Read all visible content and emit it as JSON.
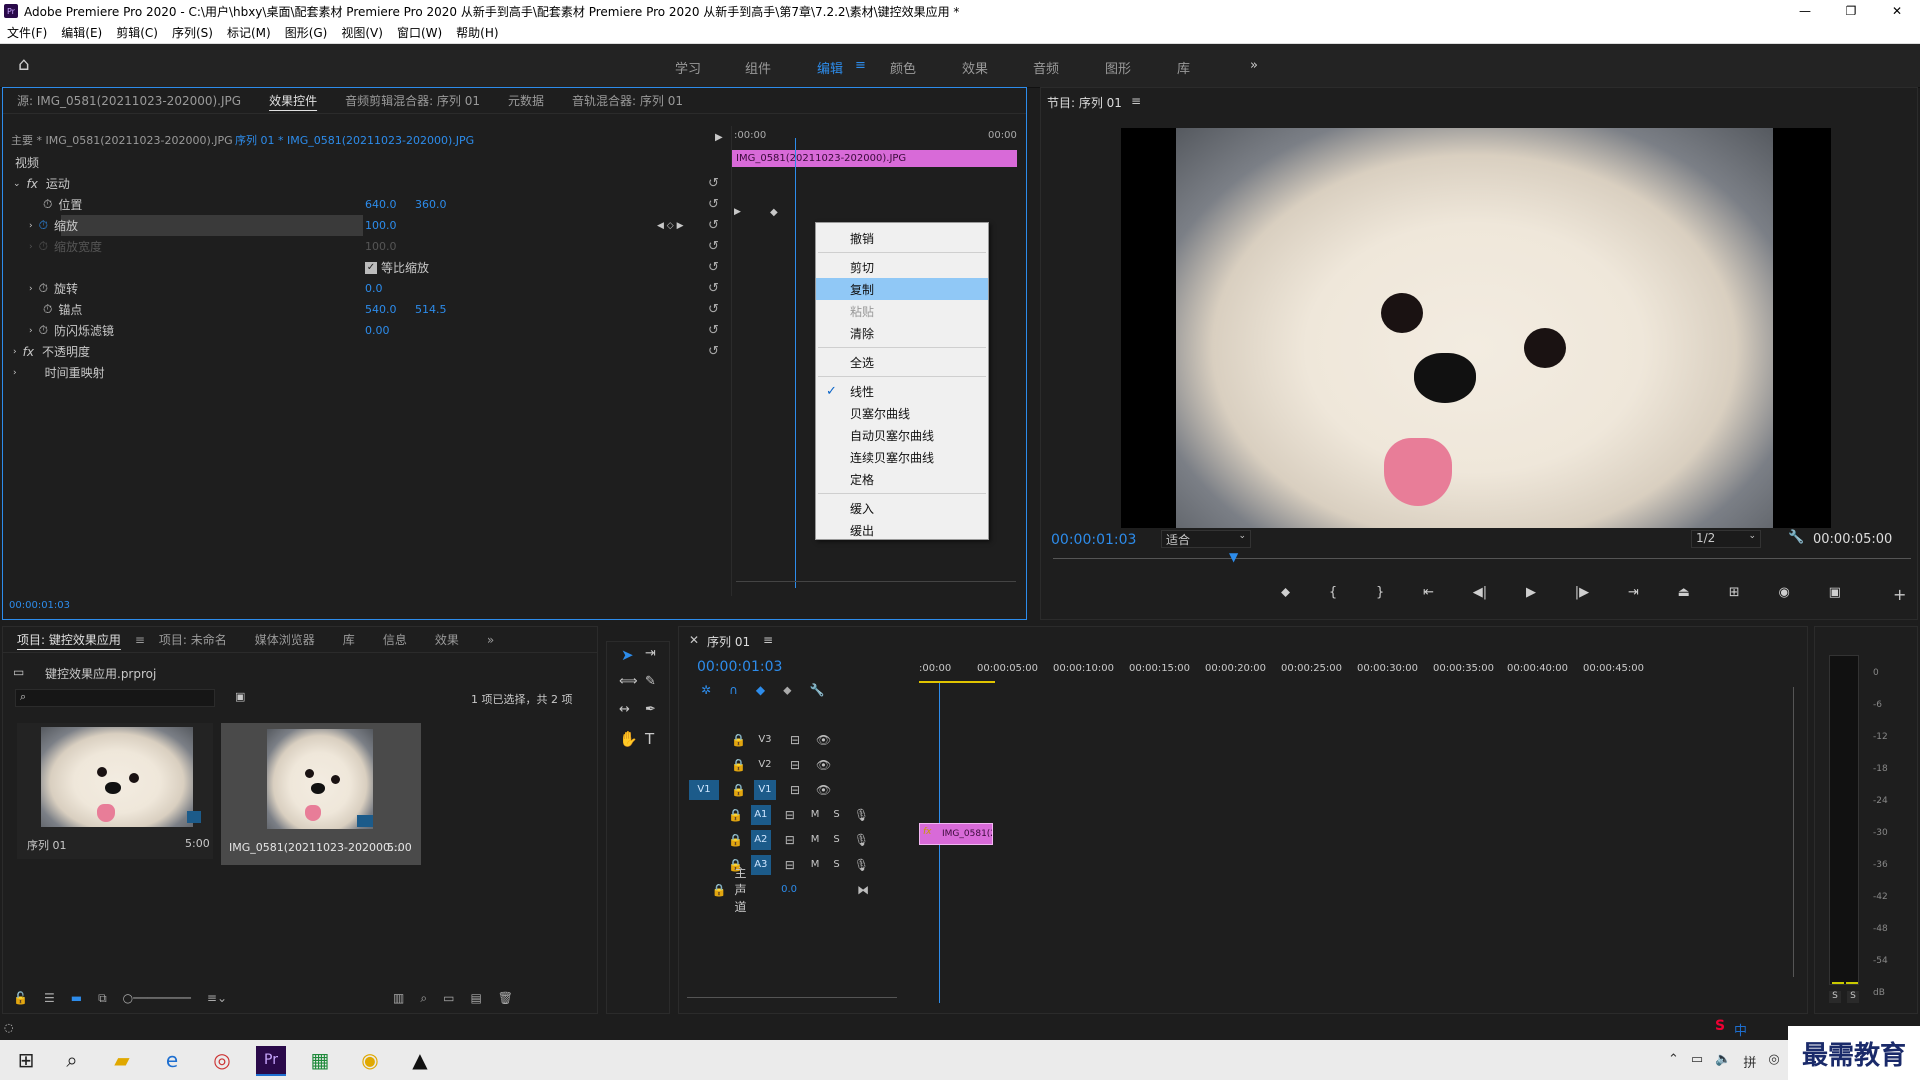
{
  "window": {
    "logo": "Pr",
    "title": "Adobe Premiere Pro 2020 - C:\\用户\\hbxy\\桌面\\配套素材 Premiere Pro 2020 从新手到高手\\配套素材 Premiere Pro 2020 从新手到高手\\第7章\\7.2.2\\素材\\键控效果应用 *",
    "minimize": "—",
    "maximize": "❐",
    "close": "✕"
  },
  "menu": [
    "文件(F)",
    "编辑(E)",
    "剪辑(C)",
    "序列(S)",
    "标记(M)",
    "图形(G)",
    "视图(V)",
    "窗口(W)",
    "帮助(H)"
  ],
  "workspaces": [
    "学习",
    "组件",
    "编辑",
    "颜色",
    "效果",
    "音频",
    "图形",
    "库"
  ],
  "workspace_active": "编辑",
  "source_panel": {
    "tabs": [
      "源: IMG_0581(20211023-202000).JPG",
      "效果控件",
      "音频剪辑混合器: 序列 01",
      "元数据",
      "音轨混合器: 序列 01"
    ],
    "master_label": "主要 * IMG_0581(20211023-202000).JPG",
    "sequence_label": "序列 01 * IMG_0581(20211023-202000).JPG",
    "ruler_start": ":00:00",
    "ruler_end": "00:00",
    "clip_label": "IMG_0581(20211023-202000).JPG",
    "section_video": "视频",
    "motion": "运动",
    "position_label": "位置",
    "position_x": "640.0",
    "position_y": "360.0",
    "scale_label": "缩放",
    "scale_value": "100.0",
    "scale_width_label": "缩放宽度",
    "scale_width_value": "100.0",
    "uniform_label": "等比缩放",
    "rotation_label": "旋转",
    "rotation_value": "0.0",
    "anchor_label": "锚点",
    "anchor_x": "540.0",
    "anchor_y": "514.5",
    "flicker_label": "防闪烁滤镜",
    "flicker_value": "0.00",
    "opacity_label": "不透明度",
    "timeremap_label": "时间重映射",
    "fx": "fx",
    "current_time": "00:00:01:03"
  },
  "context_menu": {
    "items": [
      {
        "label": "撤销",
        "state": "normal"
      },
      {
        "sep": true
      },
      {
        "label": "剪切",
        "state": "normal"
      },
      {
        "label": "复制",
        "state": "selected"
      },
      {
        "label": "粘贴",
        "state": "disabled"
      },
      {
        "label": "清除",
        "state": "normal"
      },
      {
        "sep": true
      },
      {
        "label": "全选",
        "state": "normal"
      },
      {
        "sep": true
      },
      {
        "label": "线性",
        "state": "checked"
      },
      {
        "label": "贝塞尔曲线",
        "state": "normal"
      },
      {
        "label": "自动贝塞尔曲线",
        "state": "normal"
      },
      {
        "label": "连续贝塞尔曲线",
        "state": "normal"
      },
      {
        "label": "定格",
        "state": "normal"
      },
      {
        "sep": true
      },
      {
        "label": "缓入",
        "state": "normal"
      },
      {
        "label": "缓出",
        "state": "normal"
      }
    ]
  },
  "program_monitor": {
    "title": "节目: 序列 01",
    "timecode": "00:00:01:03",
    "fit": "适合",
    "resolution": "1/2",
    "duration": "00:00:05:00"
  },
  "project_panel": {
    "tabs": [
      "项目: 键控效果应用",
      "项目: 未命名",
      "媒体浏览器",
      "库",
      "信息",
      "效果"
    ],
    "project_file": "键控效果应用.prproj",
    "selection_info": "1 项已选择，共 2 项",
    "items": [
      {
        "name": "序列 01",
        "duration": "5:00"
      },
      {
        "name": "IMG_0581(20211023-202000...",
        "duration": "5:00"
      }
    ]
  },
  "timeline": {
    "title": "序列 01",
    "timecode": "00:00:01:03",
    "ruler": [
      ":00:00",
      "00:00:05:00",
      "00:00:10:00",
      "00:00:15:00",
      "00:00:20:00",
      "00:00:25:00",
      "00:00:30:00",
      "00:00:35:00",
      "00:00:40:00",
      "00:00:45:00"
    ],
    "video_tracks": [
      "V3",
      "V2",
      "V1"
    ],
    "audio_tracks": [
      "A1",
      "A2",
      "A3"
    ],
    "source_patch": "V1",
    "master_label": "主声道",
    "master_value": "0.0",
    "clip_label": "IMG_0581(20",
    "m": "M",
    "s": "S"
  },
  "audio_meter": {
    "scale": [
      "0",
      "-6",
      "-12",
      "-18",
      "-24",
      "-30",
      "-36",
      "-42",
      "-48",
      "-54",
      "dB"
    ],
    "solo": "S"
  },
  "taskbar": {
    "ime": "中",
    "brand": "最需教育"
  }
}
